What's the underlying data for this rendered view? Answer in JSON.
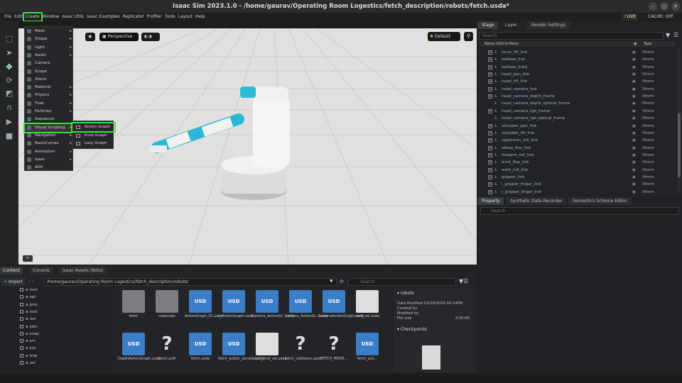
{
  "window": {
    "title": "Isaac Sim 2023.1.0 - /home/gaurav/Operating Room Logestics/fetch_description/robots/fetch.usda*"
  },
  "menubar": {
    "items": [
      "File",
      "Edit",
      "Create",
      "Window",
      "Isaac Utils",
      "Isaac Examples",
      "Replicator",
      "Profiler",
      "Tools",
      "Layout",
      "Help"
    ]
  },
  "status": {
    "live": "LIVE",
    "cache": "CACHE: OFF"
  },
  "viewport": {
    "camera": "Perspective",
    "lighting": "Default",
    "corner": "m"
  },
  "create_menu": {
    "items": [
      {
        "label": "Mesh",
        "sub": true
      },
      {
        "label": "Shape",
        "sub": true
      },
      {
        "label": "Light",
        "sub": true
      },
      {
        "label": "Audio",
        "sub": true
      },
      {
        "label": "Camera",
        "sub": false
      },
      {
        "label": "Scope",
        "sub": false
      },
      {
        "label": "Xform",
        "sub": false
      },
      {
        "label": "Material",
        "sub": true
      },
      {
        "label": "Physics",
        "sub": true
      },
      {
        "label": "Flow",
        "sub": true
      },
      {
        "label": "Particles",
        "sub": true
      },
      {
        "label": "Sequence",
        "sub": false
      },
      {
        "label": "Visual Scripting",
        "sub": true
      },
      {
        "label": "Navigation",
        "sub": true
      },
      {
        "label": "BasicCurves",
        "sub": true
      },
      {
        "label": "Animation",
        "sub": true
      },
      {
        "label": "Isaac",
        "sub": true
      },
      {
        "label": "AOV",
        "sub": false
      }
    ]
  },
  "visual_scripting_menu": {
    "items": [
      "Action Graph",
      "Push Graph",
      "Lazy Graph"
    ]
  },
  "stage": {
    "tabs": [
      "Stage",
      "Layer",
      "Render Settings"
    ],
    "search_placeholder": "Search",
    "col_name": "Name (Old to New)",
    "col_type": "Type",
    "rows": [
      {
        "name": "torso_lift_link",
        "type": "Xform",
        "exp": true
      },
      {
        "name": "bellows_link",
        "type": "Xform",
        "exp": true
      },
      {
        "name": "bellows_link2",
        "type": "Xform",
        "exp": true
      },
      {
        "name": "head_pan_link",
        "type": "Xform",
        "exp": true
      },
      {
        "name": "head_tilt_link",
        "type": "Xform",
        "exp": true
      },
      {
        "name": "head_camera_link",
        "type": "Xform",
        "exp": true
      },
      {
        "name": "head_camera_depth_frame",
        "type": "Xform",
        "exp": true
      },
      {
        "name": "head_camera_depth_optical_frame",
        "type": "Xform",
        "exp": false
      },
      {
        "name": "head_camera_rgb_frame",
        "type": "Xform",
        "exp": true
      },
      {
        "name": "head_camera_rgb_optical_frame",
        "type": "Xform",
        "exp": false
      },
      {
        "name": "shoulder_pan_link",
        "type": "Xform",
        "exp": true
      },
      {
        "name": "shoulder_lift_link",
        "type": "Xform",
        "exp": true
      },
      {
        "name": "upperarm_roll_link",
        "type": "Xform",
        "exp": true
      },
      {
        "name": "elbow_flex_link",
        "type": "Xform",
        "exp": true
      },
      {
        "name": "forearm_roll_link",
        "type": "Xform",
        "exp": true
      },
      {
        "name": "wrist_flex_link",
        "type": "Xform",
        "exp": true
      },
      {
        "name": "wrist_roll_link",
        "type": "Xform",
        "exp": true
      },
      {
        "name": "gripper_link",
        "type": "Xform",
        "exp": true
      },
      {
        "name": "l_gripper_finger_link",
        "type": "Xform",
        "exp": true
      },
      {
        "name": "r_gripper_finger_link",
        "type": "Xform",
        "exp": true
      }
    ]
  },
  "property": {
    "tabs": [
      "Property",
      "Synthetic Data Recorder",
      "Semantics Schema Editor"
    ],
    "search_placeholder": "Search"
  },
  "content": {
    "tabs": [
      "Content",
      "Console",
      "Isaac Assets (Beta)"
    ],
    "import": "Import",
    "path": "/home/gaurav/Operating Room Logestics/fetch_description/robots/",
    "search_placeholder": "Search",
    "tree": [
      "mnt",
      "opt",
      "proc",
      "root",
      "run",
      "sbin",
      "snap",
      "srv",
      "sys",
      "tmp",
      "usr"
    ],
    "files": [
      {
        "label": "fetch",
        "kind": "folder"
      },
      {
        "label": "materials",
        "kind": "folder"
      },
      {
        "label": "ActionGraph_01.usda",
        "kind": "usd"
      },
      {
        "label": "c_ActionGraph.usda",
        "kind": "usd"
      },
      {
        "label": "Camera_ActionGr...usda",
        "kind": "usd"
      },
      {
        "label": "Camera_ActionGr...usda",
        "kind": "usd"
      },
      {
        "label": "CameraActionGraph.usda",
        "kind": "usd"
      },
      {
        "label": "cmd_vel.usda",
        "kind": "thumb"
      },
      {
        "label": "DepthActionGraph.usda",
        "kind": "usd"
      },
      {
        "label": "fetch.urdf",
        "kind": "unknown"
      },
      {
        "label": "fetch.usda",
        "kind": "usd"
      },
      {
        "label": "fetch_action_serve....usda",
        "kind": "usd"
      },
      {
        "label": "fetch_cmd_vel.usda",
        "kind": "thumb"
      },
      {
        "label": "fetch_collisions.yaml",
        "kind": "unknown"
      },
      {
        "label": "FETCH_MOVE...",
        "kind": "unknown"
      },
      {
        "label": "fetch_pos...",
        "kind": "usd"
      }
    ],
    "info": {
      "name": "robots",
      "date_label": "Date Modified",
      "date": "03/29/2024 04:14PM",
      "created_label": "Created by",
      "modified_label": "Modified by",
      "size_label": "File size",
      "size": "4.00 KB",
      "checkpoints": "Checkpoints"
    }
  }
}
